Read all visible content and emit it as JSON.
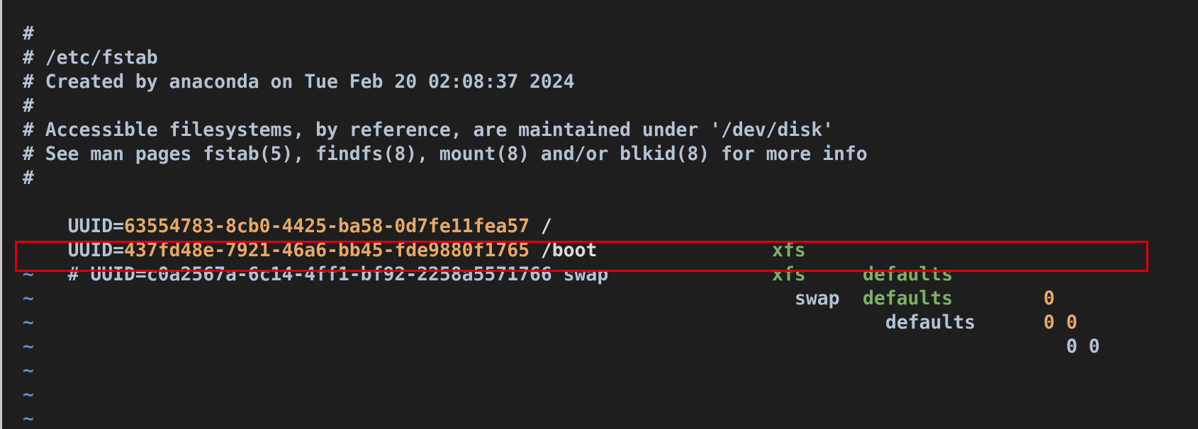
{
  "comment_lines": [
    "#",
    "# /etc/fstab",
    "# Created by anaconda on Tue Feb 20 02:08:37 2024",
    "#",
    "# Accessible filesystems, by reference, are maintained under '/dev/disk'",
    "# See man pages fstab(5), findfs(8), mount(8) and/or blkid(8) for more info",
    "#"
  ],
  "entries": [
    {
      "key": "UUID=",
      "uuid": "63554783-8cb0-4425-ba58-0d7fe11fea57",
      "mount": "/",
      "fstype": "xfs",
      "options": "defaults",
      "dump": "0",
      "pass": "0"
    },
    {
      "key": "UUID=",
      "uuid": "437fd48e-7921-46a6-bb45-fde9880f1765",
      "mount": "/boot",
      "fstype": "xfs",
      "options": "defaults",
      "dump": "0",
      "pass": "0"
    }
  ],
  "swap_line": {
    "prefix": "# UUID=c0a2567a-6c14-4ff1-bf92-2258a5571766 swap",
    "fstype": "swap",
    "options": "defaults",
    "nums": "0 0"
  },
  "tildes": [
    "~",
    "~",
    "~",
    "~",
    "~",
    "~",
    "~"
  ],
  "colors": {
    "highlight_border": "#d9000f",
    "uuid_value": "#e6a96a",
    "keyword": "#7fb06a",
    "tilde": "#5b8fd8"
  }
}
